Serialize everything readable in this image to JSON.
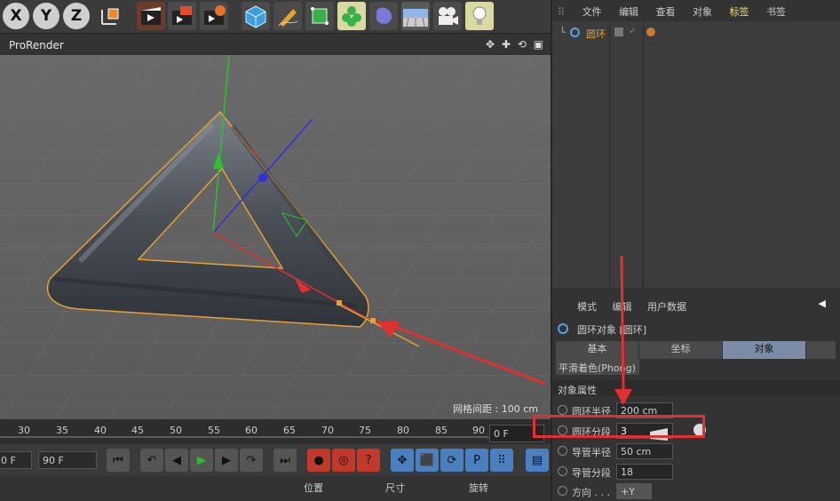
{
  "toolbar": {
    "axis_buttons": [
      "X",
      "Y",
      "Z"
    ],
    "icons": [
      "coord-system-icon",
      "render-view-icon",
      "render-picture-viewer-icon",
      "render-settings-icon",
      "cube-icon",
      "pen-icon",
      "subdivision-icon",
      "cloner-icon",
      "deformer-icon",
      "floor-icon",
      "camera-icon",
      "light-icon"
    ]
  },
  "viewport": {
    "title": "ProRender",
    "grid_spacing": "网格间距 : 100 cm",
    "nav_icons": "✥ ✚ ⟲ ▣"
  },
  "timeline": {
    "ticks": [
      "30",
      "35",
      "40",
      "45",
      "50",
      "55",
      "60",
      "65",
      "70",
      "75",
      "80",
      "85",
      "90"
    ],
    "current_frame": "0 F"
  },
  "playbar": {
    "start_field": "0 F",
    "end_field": "90 F"
  },
  "coords": {
    "position": "位置",
    "size": "尺寸",
    "rotation": "旋转"
  },
  "object_manager": {
    "menu": [
      "文件",
      "编辑",
      "查看",
      "对象",
      "标签",
      "书签"
    ],
    "object_name": "圆环"
  },
  "attributes": {
    "menu": [
      "模式",
      "编辑",
      "用户数据"
    ],
    "object_title": "圆环对象 [圆环]",
    "tabs": [
      "基本",
      "坐标",
      "对象"
    ],
    "phong": "平滑着色(Phong)",
    "section": "对象属性",
    "props": [
      {
        "name": "圆环半径",
        "value": "200 cm"
      },
      {
        "name": "圆环分段",
        "value": "3"
      },
      {
        "name": "导管半径",
        "value": "50 cm"
      },
      {
        "name": "导管分段",
        "value": "18"
      },
      {
        "name": "方向 . . .",
        "value": "+Y"
      }
    ]
  },
  "colors": {
    "accent_blue": "#7c8ca6",
    "annotation_red": "#e23030",
    "selection_orange": "#e8a030"
  }
}
